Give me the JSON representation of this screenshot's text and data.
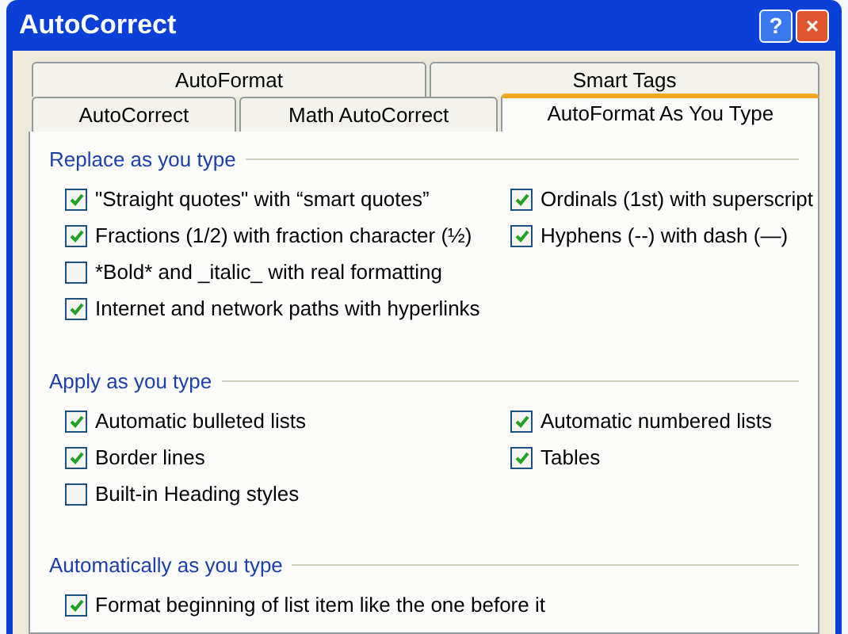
{
  "window": {
    "title": "AutoCorrect"
  },
  "title_buttons": [
    {
      "kind": "help",
      "label": "?"
    },
    {
      "kind": "close",
      "label": "×"
    }
  ],
  "tab_rows": [
    [
      {
        "label": "AutoFormat",
        "selected": false
      },
      {
        "label": "Smart Tags",
        "selected": false
      }
    ],
    [
      {
        "label": "AutoCorrect",
        "selected": false
      },
      {
        "label": "Math AutoCorrect",
        "selected": false
      },
      {
        "label": "AutoFormat As You Type",
        "selected": true
      }
    ]
  ],
  "sections": [
    {
      "title": "Replace as you type",
      "columns": [
        [
          {
            "label": "\"Straight quotes\" with “smart quotes”",
            "checked": true
          },
          {
            "label": "Fractions (1/2) with fraction character (½)",
            "checked": true
          },
          {
            "label": "*Bold* and _italic_ with real formatting",
            "checked": false
          },
          {
            "label": "Internet and network paths with hyperlinks",
            "checked": true
          }
        ],
        [
          {
            "label": "Ordinals (1st) with superscript",
            "checked": true
          },
          {
            "label": "Hyphens (--) with dash (—)",
            "checked": true
          }
        ]
      ]
    },
    {
      "title": "Apply as you type",
      "columns": [
        [
          {
            "label": "Automatic bulleted lists",
            "checked": true
          },
          {
            "label": "Border lines",
            "checked": true
          },
          {
            "label": "Built-in Heading styles",
            "checked": false
          }
        ],
        [
          {
            "label": "Automatic numbered lists",
            "checked": true
          },
          {
            "label": "Tables",
            "checked": true
          }
        ]
      ]
    },
    {
      "title": "Automatically as you type",
      "columns": [
        [
          {
            "label": "Format beginning of list item like the one before it",
            "checked": true
          }
        ]
      ]
    }
  ]
}
